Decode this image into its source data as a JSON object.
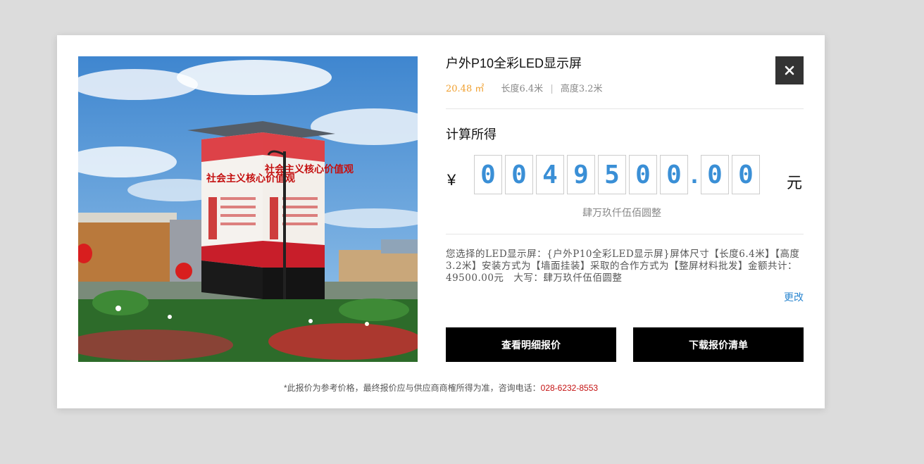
{
  "product": {
    "title": "户外P10全彩LED显示屏",
    "area": "20.48 ㎡",
    "length": "长度6.4米",
    "separator": "|",
    "height": "高度3.2米"
  },
  "calc": {
    "title": "计算所得",
    "currency_symbol": "¥",
    "digits": [
      "0",
      "0",
      "4",
      "9",
      "5",
      "0",
      "0",
      ".",
      "0",
      "0"
    ],
    "unit": "元",
    "capital_amount": "肆万玖仟伍佰圆整"
  },
  "description": "您选择的LED显示屏：{户外P10全彩LED显示屏}屏体尺寸【长度6.4米】【高度3.2米】安装方式为【墙面挂装】采取的合作方式为【整屏材料批发】金额共计：49500.00元　大写：肆万玖仟伍佰圆整",
  "change_label": "更改",
  "buttons": {
    "view_detail": "查看明细报价",
    "download_list": "下载报价清单"
  },
  "footnote": {
    "text": "*此报价为参考价格，最终报价应与供应商商榷所得为准，咨询电话：",
    "phone": "028-6232-8553"
  },
  "billboard": {
    "left_heading": "社会主义核心价值观",
    "right_heading": "社会主义核心价值观"
  },
  "colors": {
    "accent_orange": "#f0a030",
    "digit_blue": "#3a8fd6",
    "link_blue": "#2a86d0",
    "phone_red": "#c41010"
  }
}
